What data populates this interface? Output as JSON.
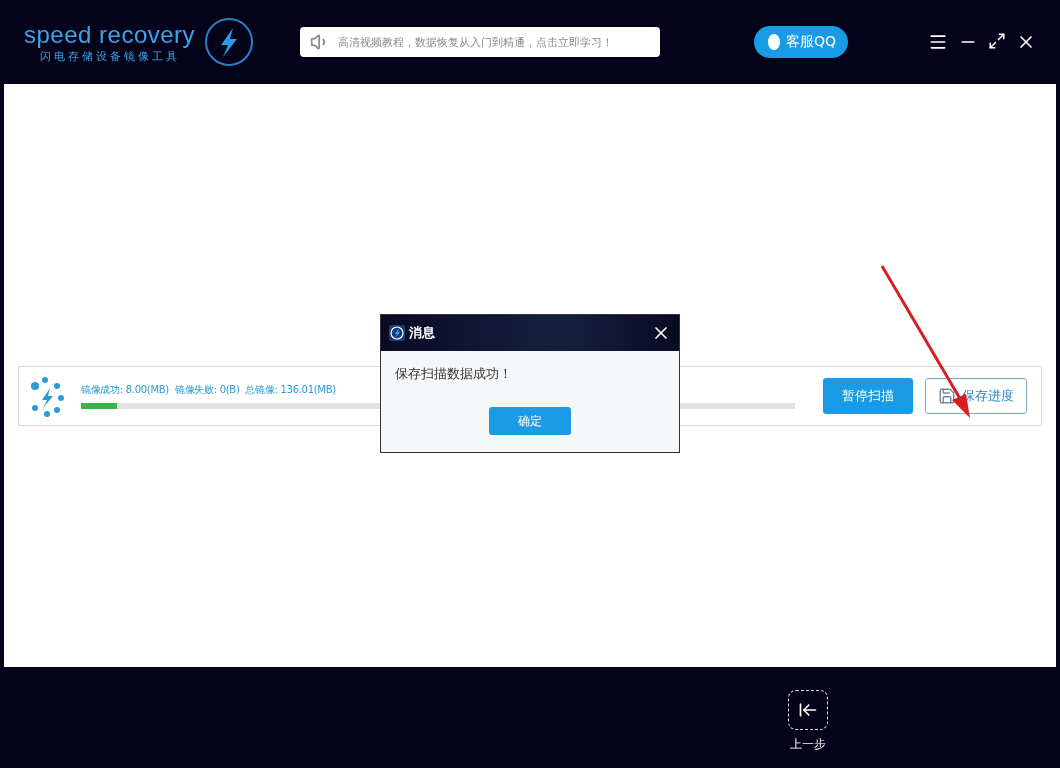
{
  "header": {
    "logo_text": "speed recovery",
    "logo_subtitle": "闪电存储设备镜像工具",
    "notice": "高清视频教程，数据恢复从入门到精通，点击立即学习！",
    "support_button": "客服QQ"
  },
  "progress": {
    "stats": [
      "镜像成功: 8.00(MB)",
      "镜像失败: 0(B)",
      "总镜像: 136.01(MB)"
    ],
    "level": 0.05,
    "pause_button": "暂停扫描",
    "save_button": "保存进度"
  },
  "dialog": {
    "title": "消息",
    "message": "保存扫描数据成功！",
    "ok_button": "确定"
  },
  "footer": {
    "back_label": "上一步"
  }
}
